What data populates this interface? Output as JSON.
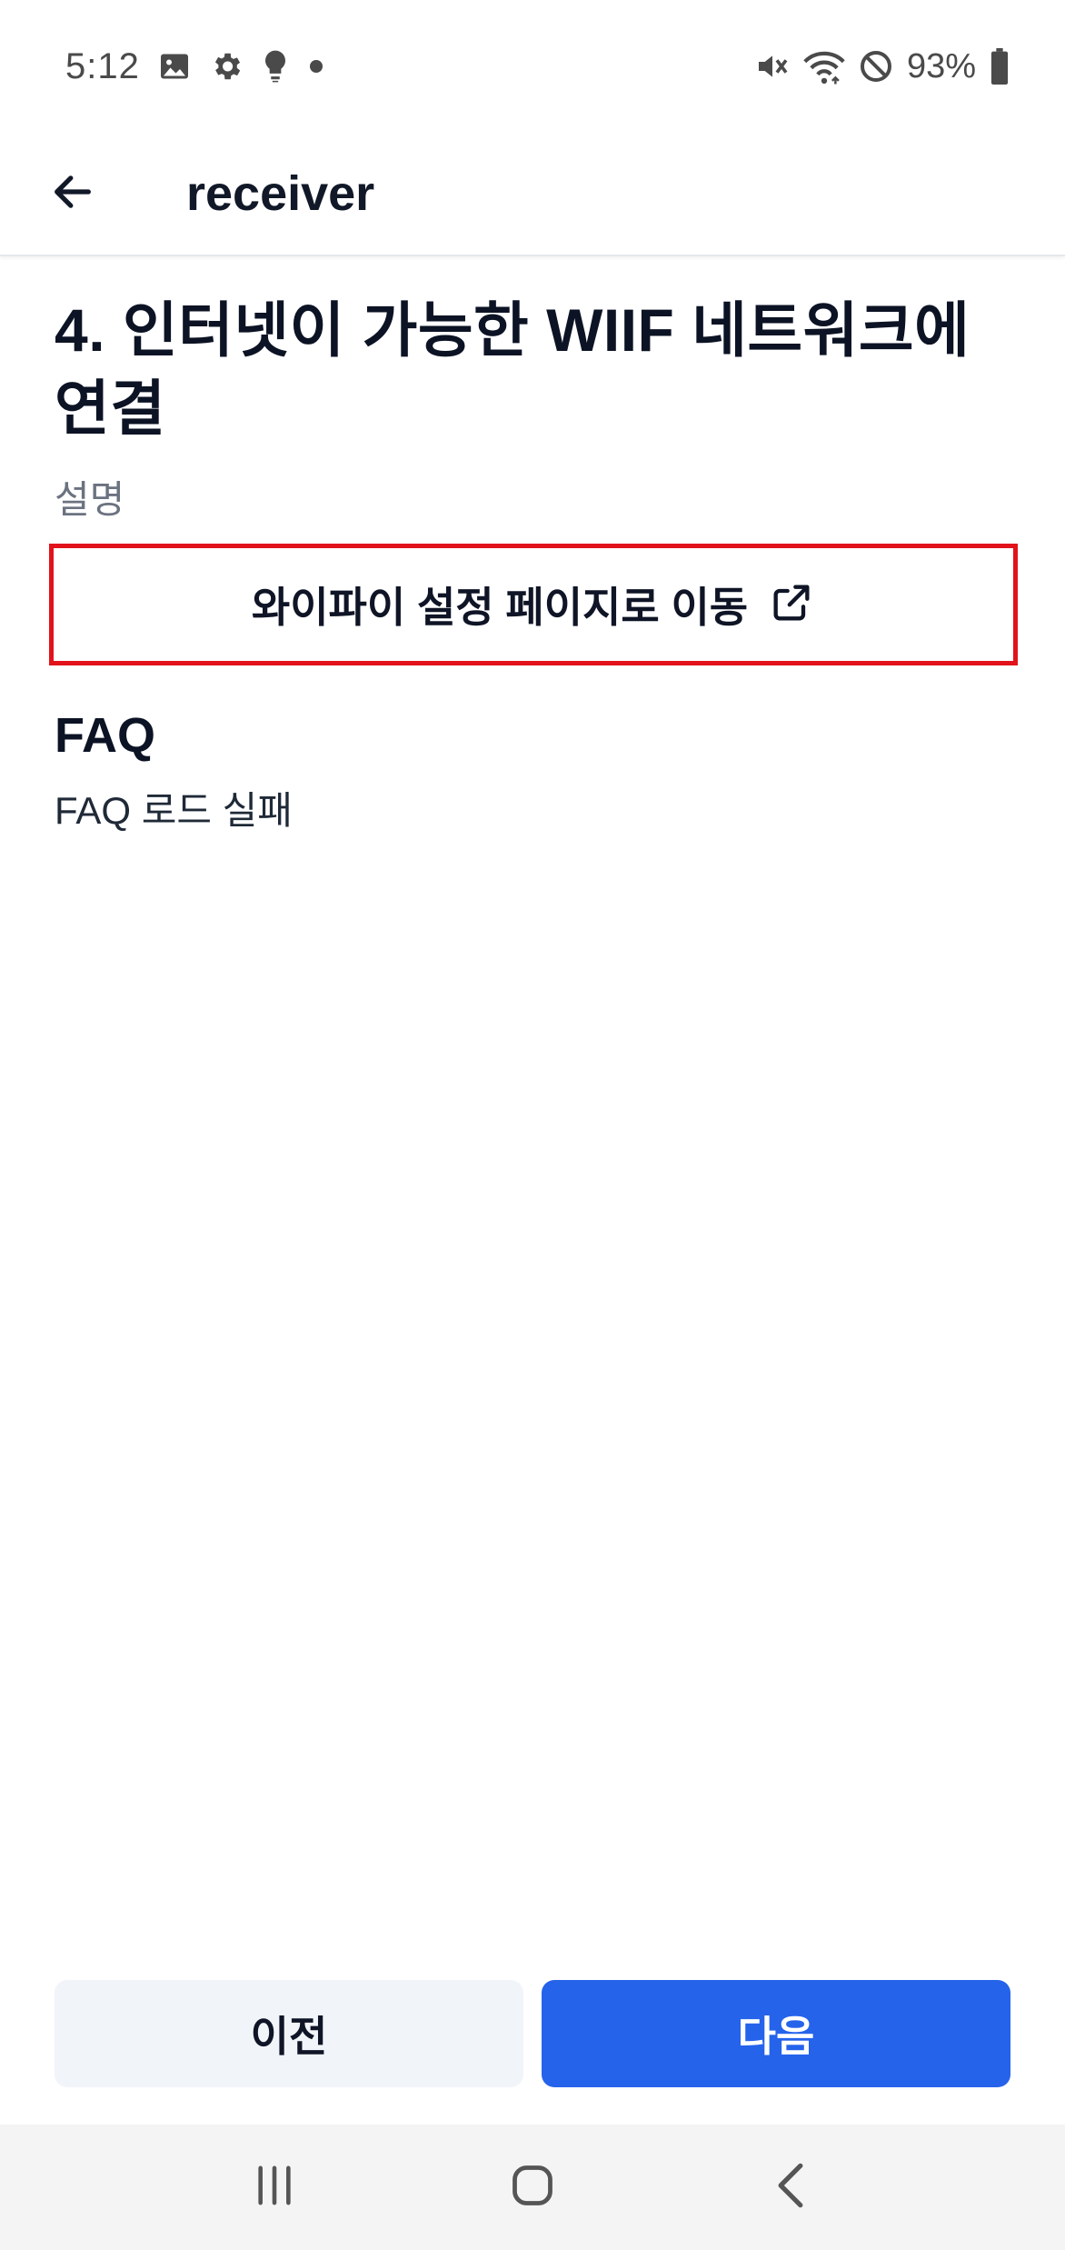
{
  "status_bar": {
    "time": "5:12",
    "battery_percent": "93%",
    "left_icons": [
      "image-icon",
      "gear-icon",
      "bulb-icon",
      "dot-icon"
    ],
    "right_icons": [
      "vibrate-mute-icon",
      "wifi-icon",
      "dnd-icon",
      "battery-icon"
    ]
  },
  "app_bar": {
    "title": "receiver",
    "back_icon": "arrow-left-icon"
  },
  "step": {
    "title_line1": "4. 인터넷이 가능한 WIIF 네트워크에",
    "title_line2": "연결",
    "description": "설명"
  },
  "wifi_settings_button": {
    "label": "와이파이 설정 페이지로 이동",
    "icon": "external-link-icon",
    "border_color": "#e2121b"
  },
  "faq": {
    "title": "FAQ",
    "message": "FAQ 로드 실패"
  },
  "actions": {
    "prev_label": "이전",
    "next_label": "다음",
    "accent_color": "#2563eb"
  },
  "nav_bar": {
    "icons": [
      "recent-apps-icon",
      "home-icon",
      "back-icon"
    ]
  }
}
